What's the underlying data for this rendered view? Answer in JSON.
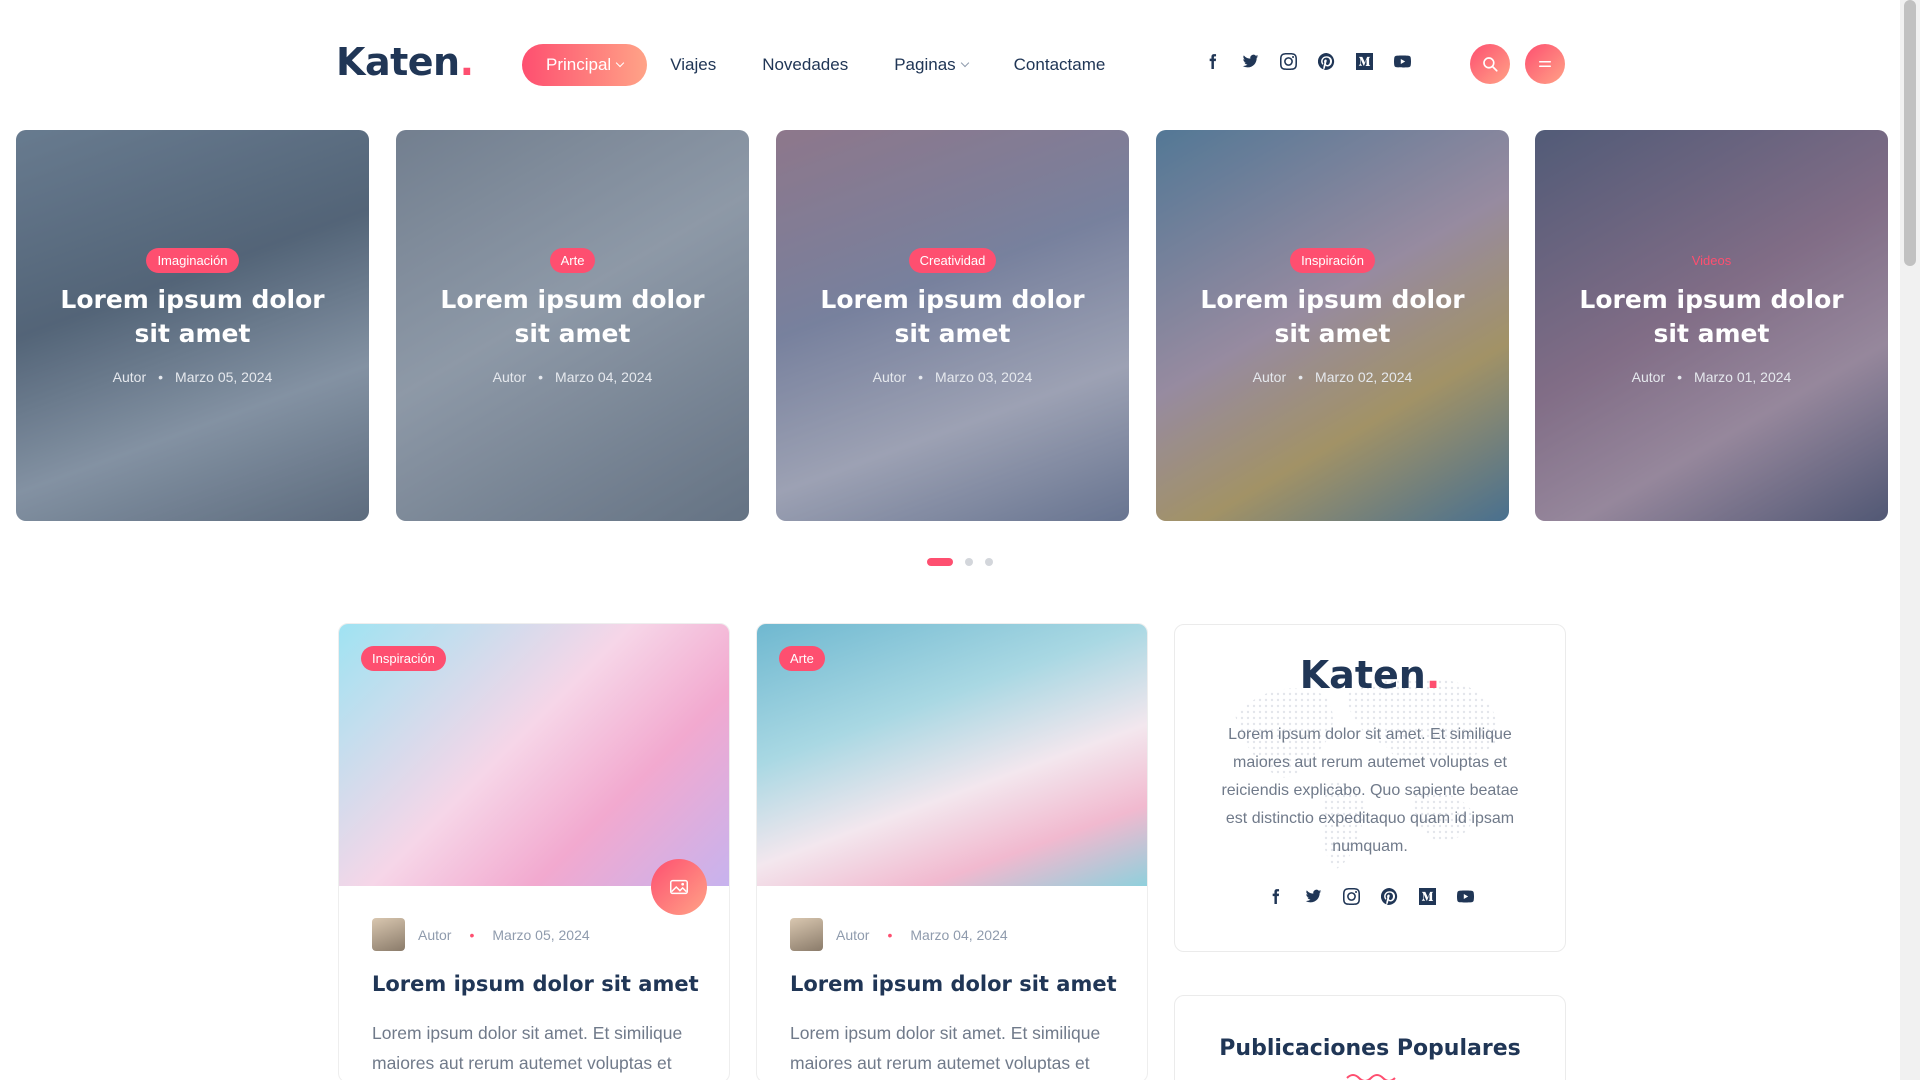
{
  "brand": {
    "name": "Katen",
    "dot": "."
  },
  "nav": {
    "items": [
      {
        "label": "Principal",
        "active": true,
        "dropdown": true
      },
      {
        "label": "Viajes",
        "active": false,
        "dropdown": false
      },
      {
        "label": "Novedades",
        "active": false,
        "dropdown": false
      },
      {
        "label": "Paginas",
        "active": false,
        "dropdown": true
      },
      {
        "label": "Contactame",
        "active": false,
        "dropdown": false
      }
    ]
  },
  "socials": [
    "facebook-icon",
    "twitter-icon",
    "instagram-icon",
    "pinterest-icon",
    "medium-icon",
    "youtube-icon"
  ],
  "header_buttons": [
    "search-icon",
    "menu-icon"
  ],
  "slider": {
    "slides": [
      {
        "category": "Imaginación",
        "title": "Lorem ipsum dolor sit amet",
        "author": "Autor",
        "date": "Marzo 05, 2024"
      },
      {
        "category": "Arte",
        "title": "Lorem ipsum dolor sit amet",
        "author": "Autor",
        "date": "Marzo 04, 2024"
      },
      {
        "category": "Creatividad",
        "title": "Lorem ipsum dolor sit amet",
        "author": "Autor",
        "date": "Marzo 03, 2024"
      },
      {
        "category": "Inspiración",
        "title": "Lorem ipsum dolor sit amet",
        "author": "Autor",
        "date": "Marzo 02, 2024"
      },
      {
        "category": "Videos",
        "title": "Lorem ipsum dolor sit amet",
        "author": "Autor",
        "date": "Marzo 01, 2024"
      }
    ],
    "pages": 3,
    "active_page": 1
  },
  "posts": [
    {
      "category": "Inspiración",
      "author": "Autor",
      "date": "Marzo 05, 2024",
      "title": "Lorem ipsum dolor sit amet",
      "excerpt": "Lorem ipsum dolor sit amet. Et similique maiores aut rerum autemet voluptas et",
      "format_icon": "image-icon"
    },
    {
      "category": "Arte",
      "author": "Autor",
      "date": "Marzo 04, 2024",
      "title": "Lorem ipsum dolor sit amet",
      "excerpt": "Lorem ipsum dolor sit amet. Et similique maiores aut rerum autemet voluptas et"
    }
  ],
  "sidebar": {
    "about": {
      "logo": "Katen",
      "text": "Lorem ipsum dolor sit amet. Et similique maiores aut rerum autemet voluptas et reiciendis explicabo. Quo sapiente beatae est distinctio expeditaquo quam id ipsam numquam."
    },
    "popular": {
      "title": "Publicaciones Populares"
    }
  },
  "colors": {
    "accent": "#fe4f70",
    "accent_light": "#ffa387",
    "heading": "#203656",
    "text": "#707a8a"
  }
}
